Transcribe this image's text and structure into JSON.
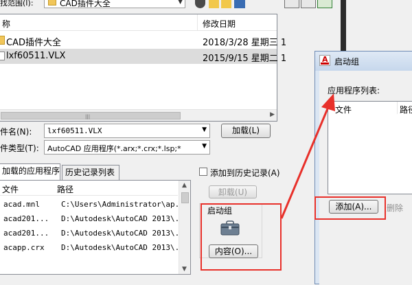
{
  "top": {
    "lookin_label": "找范围(I):",
    "folder_name": "CAD插件大全"
  },
  "file_list": {
    "col_name": "称",
    "col_date": "修改日期",
    "rows": [
      {
        "name": "CAD插件大全",
        "date": "2018/3/28 星期三 1",
        "type": "folder"
      },
      {
        "name": "lxf60511.VLX",
        "date": "2015/9/15 星期二 1",
        "type": "file"
      }
    ]
  },
  "filename": {
    "label": "件名(N):",
    "value": "lxf60511.VLX",
    "load_button": "加载(L)"
  },
  "filetype": {
    "label": "件类型(T):",
    "value": "AutoCAD 应用程序(*.arx;*.crx;*.lsp;*"
  },
  "tabs": [
    {
      "label": "加载的应用程序"
    },
    {
      "label": "历史记录列表"
    }
  ],
  "add_history": "添加到历史记录(A)",
  "unload_button": "卸载(U)",
  "apps": {
    "col_file": "文件",
    "col_path": "路径",
    "rows": [
      {
        "file": "acad.mnl",
        "path": "C:\\Users\\Administrator\\ap..."
      },
      {
        "file": "acad201...",
        "path": "D:\\Autodesk\\AutoCAD 2013\\..."
      },
      {
        "file": "acad201...",
        "path": "D:\\Autodesk\\AutoCAD 2013\\..."
      },
      {
        "file": "acapp.crx",
        "path": "D:\\Autodesk\\AutoCAD 2013\\..."
      }
    ]
  },
  "startup_group": {
    "title": "启动组",
    "contents_button": "内容(O)..."
  },
  "dialog": {
    "title": "启动组",
    "list_label": "应用程序列表:",
    "col_file": "文件",
    "col_path": "路径",
    "add_button": "添加(A)...",
    "delete_button": "删除"
  },
  "colors": {
    "annotation_red": "#e8302a",
    "window_bg": "#f0f0f0",
    "dark_separator": "#2b2b2b"
  }
}
